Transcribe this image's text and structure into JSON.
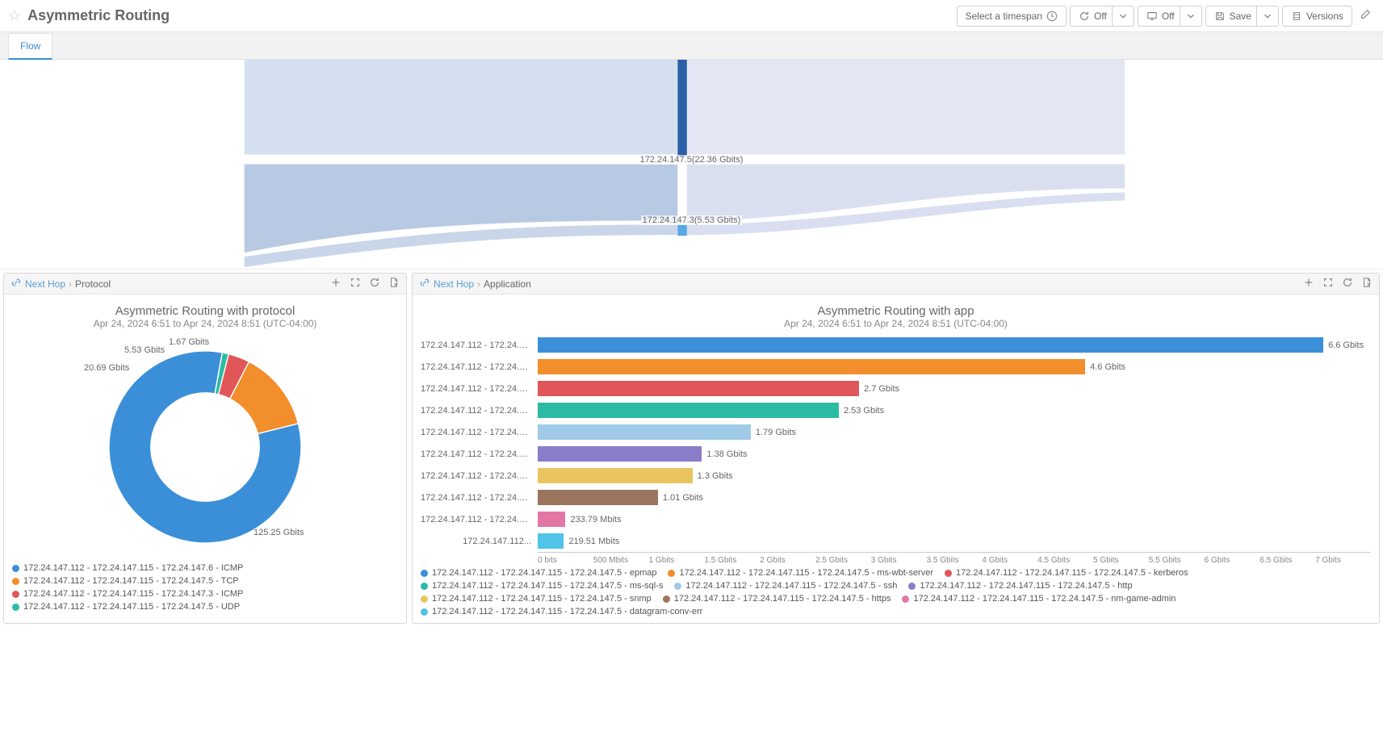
{
  "header": {
    "title": "Asymmetric Routing",
    "timespan_label": "Select a timespan",
    "off1": "Off",
    "off2": "Off",
    "save": "Save",
    "versions": "Versions"
  },
  "tabs": {
    "flow": "Flow"
  },
  "sankey": {
    "node1": "172.24.147.5(22.36 Gbits)",
    "node2": "172.24.147.3(5.53 Gbits)"
  },
  "panel_left": {
    "crumb1": "Next Hop",
    "crumb2": "Protocol",
    "title": "Asymmetric Routing with protocol",
    "subtitle": "Apr 24, 2024 6:51 to Apr 24, 2024 8:51 (UTC-04:00)",
    "labels": {
      "a": "125.25 Gbits",
      "b": "20.69 Gbits",
      "c": "5.53 Gbits",
      "d": "1.67 Gbits"
    },
    "legend": [
      {
        "color": "#3a8fd8",
        "text": "172.24.147.112 - 172.24.147.115 - 172.24.147.6 - ICMP"
      },
      {
        "color": "#f28e2c",
        "text": "172.24.147.112 - 172.24.147.115 - 172.24.147.5 - TCP"
      },
      {
        "color": "#e15759",
        "text": "172.24.147.112 - 172.24.147.115 - 172.24.147.3 - ICMP"
      },
      {
        "color": "#2bbba5",
        "text": "172.24.147.112 - 172.24.147.115 - 172.24.147.5 - UDP"
      }
    ]
  },
  "panel_right": {
    "crumb1": "Next Hop",
    "crumb2": "Application",
    "title": "Asymmetric Routing with app",
    "subtitle": "Apr 24, 2024 6:51 to Apr 24, 2024 8:51 (UTC-04:00)",
    "x_ticks": [
      "0 bits",
      "500 Mbits",
      "1 Gbits",
      "1.5 Gbits",
      "2 Gbits",
      "2.5 Gbits",
      "3 Gbits",
      "3.5 Gbits",
      "4 Gbits",
      "4.5 Gbits",
      "5 Gbits",
      "5.5 Gbits",
      "6 Gbits",
      "6.5 Gbits",
      "7 Gbits"
    ],
    "legend": [
      {
        "color": "#3a8fd8",
        "text": "172.24.147.112 - 172.24.147.115 - 172.24.147.5 - epmap"
      },
      {
        "color": "#f28e2c",
        "text": "172.24.147.112 - 172.24.147.115 - 172.24.147.5 - ms-wbt-server"
      },
      {
        "color": "#e15759",
        "text": "172.24.147.112 - 172.24.147.115 - 172.24.147.5 - kerberos"
      },
      {
        "color": "#2bbba5",
        "text": "172.24.147.112 - 172.24.147.115 - 172.24.147.5 - ms-sql-s"
      },
      {
        "color": "#a0cbe8",
        "text": "172.24.147.112 - 172.24.147.115 - 172.24.147.5 - ssh"
      },
      {
        "color": "#8a7cc9",
        "text": "172.24.147.112 - 172.24.147.115 - 172.24.147.5 - http"
      },
      {
        "color": "#e8c55f",
        "text": "172.24.147.112 - 172.24.147.115 - 172.24.147.5 - snmp"
      },
      {
        "color": "#9c755f",
        "text": "172.24.147.112 - 172.24.147.115 - 172.24.147.5 - https"
      },
      {
        "color": "#e377a3",
        "text": "172.24.147.112 - 172.24.147.115 - 172.24.147.5 - nm-game-admin"
      },
      {
        "color": "#4fc3e8",
        "text": "172.24.147.112 - 172.24.147.115 - 172.24.147.5 - datagram-conv-err"
      }
    ]
  },
  "chart_data": [
    {
      "type": "pie",
      "title": "Asymmetric Routing with protocol",
      "series": [
        {
          "name": "172.24.147.112 - 172.24.147.115 - 172.24.147.6 - ICMP",
          "value": 125.25,
          "unit": "Gbits",
          "color": "#3a8fd8"
        },
        {
          "name": "172.24.147.112 - 172.24.147.115 - 172.24.147.5 - TCP",
          "value": 20.69,
          "unit": "Gbits",
          "color": "#f28e2c"
        },
        {
          "name": "172.24.147.112 - 172.24.147.115 - 172.24.147.3 - ICMP",
          "value": 5.53,
          "unit": "Gbits",
          "color": "#e15759"
        },
        {
          "name": "172.24.147.112 - 172.24.147.115 - 172.24.147.5 - UDP",
          "value": 1.67,
          "unit": "Gbits",
          "color": "#2bbba5"
        }
      ]
    },
    {
      "type": "bar",
      "title": "Asymmetric Routing with app",
      "xlabel": "",
      "ylabel": "",
      "xlim_bits": [
        0,
        7000000000
      ],
      "categories": [
        "172.24.147.112 - 172.24.147.1...",
        "172.24.147.112 - 172.24.147.1...",
        "172.24.147.112 - 172.24.147.1...",
        "172.24.147.112 - 172.24.147.1...",
        "172.24.147.112 - 172.24.147.1...",
        "172.24.147.112 - 172.24.147.1...",
        "172.24.147.112 - 172.24.147.1...",
        "172.24.147.112 - 172.24.147.1...",
        "172.24.147.112 - 172.24.147.1...",
        "172.24.147.112..."
      ],
      "values_bits": [
        6600000000,
        4600000000,
        2700000000,
        2530000000,
        1790000000,
        1380000000,
        1300000000,
        1010000000,
        233790000,
        219510000
      ],
      "value_labels": [
        "6.6 Gbits",
        "4.6 Gbits",
        "2.7 Gbits",
        "2.53 Gbits",
        "1.79 Gbits",
        "1.38 Gbits",
        "1.3 Gbits",
        "1.01 Gbits",
        "233.79 Mbits",
        "219.51 Mbits"
      ],
      "colors": [
        "#3a8fd8",
        "#f28e2c",
        "#e15759",
        "#2bbba5",
        "#a0cbe8",
        "#8a7cc9",
        "#e8c55f",
        "#9c755f",
        "#e377a3",
        "#4fc3e8"
      ]
    },
    {
      "type": "sankey",
      "nodes": [
        {
          "name": "172.24.147.5",
          "value": 22.36,
          "unit": "Gbits"
        },
        {
          "name": "172.24.147.3",
          "value": 5.53,
          "unit": "Gbits"
        }
      ]
    }
  ]
}
